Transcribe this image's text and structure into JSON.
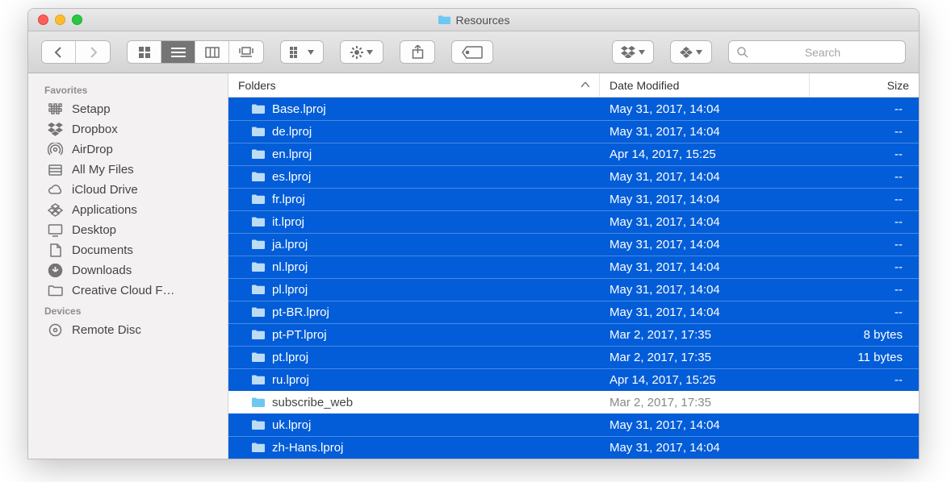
{
  "window_title": "Resources",
  "search_placeholder": "Search",
  "sidebar": {
    "sections": [
      {
        "header": "Favorites",
        "items": [
          {
            "icon": "grid",
            "label": "Setapp"
          },
          {
            "icon": "dropbox",
            "label": "Dropbox"
          },
          {
            "icon": "airdrop",
            "label": "AirDrop"
          },
          {
            "icon": "allfiles",
            "label": "All My Files"
          },
          {
            "icon": "cloud",
            "label": "iCloud Drive"
          },
          {
            "icon": "apps",
            "label": "Applications"
          },
          {
            "icon": "desktop",
            "label": "Desktop"
          },
          {
            "icon": "doc",
            "label": "Documents"
          },
          {
            "icon": "download",
            "label": "Downloads"
          },
          {
            "icon": "folder",
            "label": "Creative Cloud F…"
          }
        ]
      },
      {
        "header": "Devices",
        "items": [
          {
            "icon": "disc",
            "label": "Remote Disc"
          }
        ]
      }
    ]
  },
  "columns": {
    "name": "Folders",
    "date": "Date Modified",
    "size": "Size"
  },
  "files": [
    {
      "name": "Base.lproj",
      "date": "May 31, 2017, 14:04",
      "size": "--",
      "selected": true
    },
    {
      "name": "de.lproj",
      "date": "May 31, 2017, 14:04",
      "size": "--",
      "selected": true
    },
    {
      "name": "en.lproj",
      "date": "Apr 14, 2017, 15:25",
      "size": "--",
      "selected": true
    },
    {
      "name": "es.lproj",
      "date": "May 31, 2017, 14:04",
      "size": "--",
      "selected": true
    },
    {
      "name": "fr.lproj",
      "date": "May 31, 2017, 14:04",
      "size": "--",
      "selected": true
    },
    {
      "name": "it.lproj",
      "date": "May 31, 2017, 14:04",
      "size": "--",
      "selected": true
    },
    {
      "name": "ja.lproj",
      "date": "May 31, 2017, 14:04",
      "size": "--",
      "selected": true
    },
    {
      "name": "nl.lproj",
      "date": "May 31, 2017, 14:04",
      "size": "--",
      "selected": true
    },
    {
      "name": "pl.lproj",
      "date": "May 31, 2017, 14:04",
      "size": "--",
      "selected": true
    },
    {
      "name": "pt-BR.lproj",
      "date": "May 31, 2017, 14:04",
      "size": "--",
      "selected": true
    },
    {
      "name": "pt-PT.lproj",
      "date": "Mar 2, 2017, 17:35",
      "size": "8 bytes",
      "selected": true
    },
    {
      "name": "pt.lproj",
      "date": "Mar 2, 2017, 17:35",
      "size": "11 bytes",
      "selected": true
    },
    {
      "name": "ru.lproj",
      "date": "Apr 14, 2017, 15:25",
      "size": "--",
      "selected": true
    },
    {
      "name": "subscribe_web",
      "date": "Mar 2, 2017, 17:35",
      "size": "",
      "selected": false
    },
    {
      "name": "uk.lproj",
      "date": "May 31, 2017, 14:04",
      "size": "",
      "selected": true
    },
    {
      "name": "zh-Hans.lproj",
      "date": "May 31, 2017, 14:04",
      "size": "",
      "selected": true
    }
  ]
}
